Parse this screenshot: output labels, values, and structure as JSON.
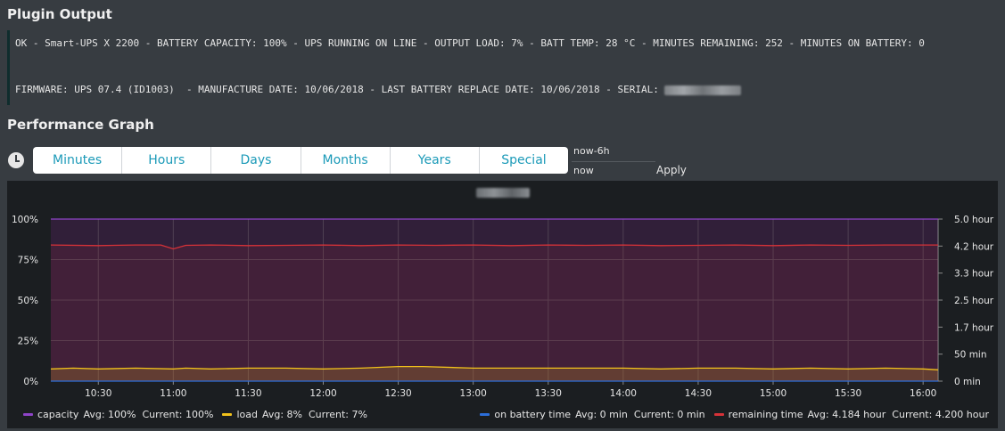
{
  "plugin_output": {
    "title": "Plugin Output",
    "line1": "OK - Smart-UPS X 2200 - BATTERY CAPACITY: 100% - UPS RUNNING ON LINE - OUTPUT LOAD: 7% - BATT TEMP: 28 °C - MINUTES REMAINING: 252 - MINUTES ON BATTERY: 0",
    "line2": "FIRMWARE: UPS 07.4 (ID1003)  - MANUFACTURE DATE: 10/06/2018 - LAST BATTERY REPLACE DATE: 10/06/2018 - SERIAL: "
  },
  "perf": {
    "title": "Performance Graph",
    "buttons": [
      "Minutes",
      "Hours",
      "Days",
      "Months",
      "Years",
      "Special"
    ],
    "range_from": "now-6h",
    "range_to": "now",
    "apply_label": "Apply"
  },
  "colors": {
    "capacity": "#8e44c8",
    "load": "#f2c21b",
    "on_battery": "#2c6ed9",
    "remaining": "#d63238"
  },
  "chart_data": {
    "type": "line",
    "x_ticks": [
      "10:30",
      "11:00",
      "11:30",
      "12:00",
      "12:30",
      "13:00",
      "13:30",
      "14:00",
      "14:30",
      "15:00",
      "15:30",
      "16:00"
    ],
    "x_range": [
      "10:11",
      "16:06"
    ],
    "y_left_ticks": [
      "100%",
      "75%",
      "50%",
      "25%",
      "0%"
    ],
    "y_left_range": [
      0,
      100
    ],
    "y_right_ticks": [
      "5.0 hour",
      "4.2 hour",
      "3.3 hour",
      "2.5 hour",
      "1.7 hour",
      "50 min",
      "0 min"
    ],
    "y_right_range_hours": [
      0,
      5.0
    ],
    "grid": true,
    "series": [
      {
        "name": "capacity",
        "axis": "left",
        "stats": "Avg: 100%  Current: 100%",
        "x": [
          "10:11",
          "16:06"
        ],
        "values": [
          100,
          100
        ]
      },
      {
        "name": "load",
        "axis": "left",
        "stats": "Avg: 8%  Current: 7%",
        "x": [
          "10:11",
          "10:20",
          "10:30",
          "10:45",
          "11:00",
          "11:05",
          "11:15",
          "11:30",
          "11:45",
          "12:00",
          "12:15",
          "12:30",
          "12:40",
          "13:00",
          "13:15",
          "13:30",
          "13:45",
          "14:00",
          "14:15",
          "14:30",
          "14:45",
          "15:00",
          "15:15",
          "15:30",
          "15:45",
          "16:00",
          "16:06"
        ],
        "values": [
          7.5,
          8,
          7.5,
          8,
          7.5,
          8,
          7.5,
          8,
          8,
          7.5,
          8,
          9,
          9,
          8,
          8,
          8,
          8,
          8,
          7.5,
          8,
          8,
          7.5,
          8,
          7.5,
          8,
          7.5,
          7
        ]
      },
      {
        "name": "on battery time",
        "axis": "right",
        "stats": "Avg: 0 min  Current: 0 min",
        "x": [
          "10:11",
          "16:06"
        ],
        "values": [
          0,
          0
        ]
      },
      {
        "name": "remaining time",
        "axis": "right",
        "stats": "Avg: 4.184 hour  Current: 4.200 hour",
        "x": [
          "10:11",
          "10:30",
          "10:45",
          "10:55",
          "11:00",
          "11:05",
          "11:15",
          "11:30",
          "11:45",
          "12:00",
          "12:15",
          "12:30",
          "12:45",
          "13:00",
          "13:15",
          "13:30",
          "13:45",
          "14:00",
          "14:15",
          "14:30",
          "14:45",
          "15:00",
          "15:15",
          "15:30",
          "15:45",
          "16:00",
          "16:06"
        ],
        "values": [
          4.2,
          4.18,
          4.2,
          4.2,
          4.08,
          4.19,
          4.2,
          4.18,
          4.19,
          4.2,
          4.18,
          4.2,
          4.19,
          4.2,
          4.18,
          4.2,
          4.19,
          4.2,
          4.18,
          4.19,
          4.2,
          4.18,
          4.2,
          4.19,
          4.2,
          4.2,
          4.2
        ]
      }
    ]
  }
}
